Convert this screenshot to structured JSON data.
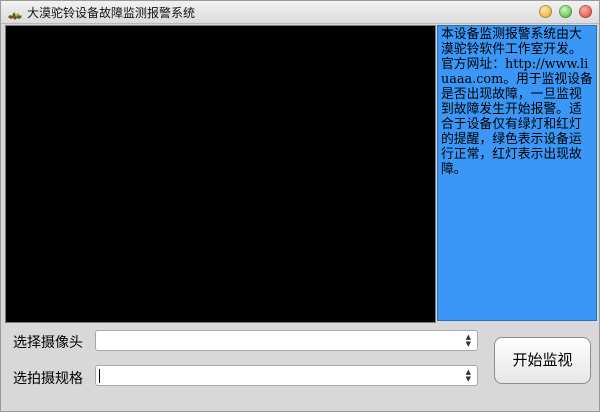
{
  "window": {
    "title": "大漠驼铃设备故障监测报警系统",
    "icon": "camel-icon"
  },
  "info_panel": {
    "text": "本设备监测报警系统由大漠驼铃软件工作室开发。官方网址：http://www.liuaaa.com。用于监视设备是否出现故障，一旦监视到故障发生开始报警。适合于设备仅有绿灯和红灯的提醒，绿色表示设备运行正常，红灯表示出现故障。",
    "background": "#3a97f6"
  },
  "form": {
    "camera_label": "选择摄像头",
    "camera_value": "",
    "spec_label": "选拍摄规格",
    "spec_value": ""
  },
  "start_button": {
    "label": "开始监视"
  },
  "colors": {
    "video_bg": "#000000",
    "window_bg": "#d8d8d8"
  }
}
